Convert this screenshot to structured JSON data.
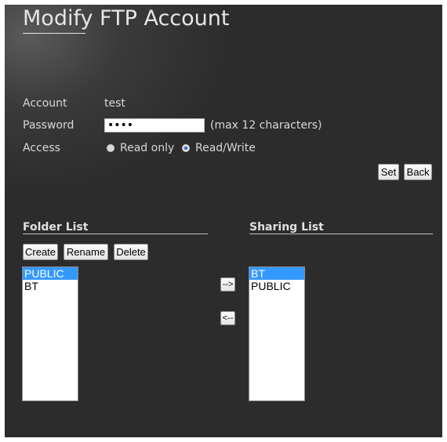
{
  "page": {
    "title": "Modify FTP Account"
  },
  "form": {
    "account_label": "Account",
    "account_value": "test",
    "password_label": "Password",
    "password_value": "••••",
    "password_hint": "(max 12 characters)",
    "access_label": "Access",
    "access_options": [
      {
        "label": "Read only",
        "selected": false
      },
      {
        "label": "Read/Write",
        "selected": true
      }
    ]
  },
  "actions": {
    "set_label": "Set",
    "back_label": "Back"
  },
  "folder_list": {
    "title": "Folder List",
    "create_label": "Create",
    "rename_label": "Rename",
    "delete_label": "Delete",
    "items": [
      {
        "label": "PUBLIC",
        "selected": true
      },
      {
        "label": "BT",
        "selected": false
      }
    ]
  },
  "transfer": {
    "add_label": "-->",
    "remove_label": "<--"
  },
  "sharing_list": {
    "title": "Sharing List",
    "items": [
      {
        "label": "BT",
        "selected": true
      },
      {
        "label": "PUBLIC",
        "selected": false
      }
    ]
  },
  "colors": {
    "panel_background": "#2c2c2c",
    "selection": "#3399ff",
    "radio_dot": "#2b6ad6"
  }
}
